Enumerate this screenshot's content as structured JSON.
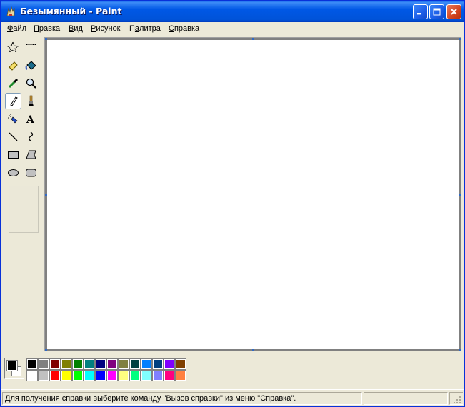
{
  "window": {
    "title": "Безымянный - Paint"
  },
  "menu": [
    {
      "label_pre": "",
      "label_ul": "Ф",
      "label_post": "айл"
    },
    {
      "label_pre": "",
      "label_ul": "П",
      "label_post": "равка"
    },
    {
      "label_pre": "",
      "label_ul": "В",
      "label_post": "ид"
    },
    {
      "label_pre": "",
      "label_ul": "Р",
      "label_post": "исунок"
    },
    {
      "label_pre": "П",
      "label_ul": "а",
      "label_post": "литра"
    },
    {
      "label_pre": "",
      "label_ul": "С",
      "label_post": "правка"
    }
  ],
  "tools": [
    "free-select-icon",
    "rect-select-icon",
    "eraser-icon",
    "fill-bucket-icon",
    "color-picker-icon",
    "magnifier-icon",
    "pencil-icon",
    "brush-icon",
    "airbrush-icon",
    "text-icon",
    "line-icon",
    "curve-icon",
    "rectangle-icon",
    "polygon-icon",
    "ellipse-icon",
    "rounded-rect-icon"
  ],
  "selected_tool": "pencil-icon",
  "colors": {
    "foreground": "#000000",
    "background": "#ffffff",
    "palette_top": [
      "#000000",
      "#808080",
      "#800000",
      "#808000",
      "#008000",
      "#008080",
      "#000080",
      "#800080",
      "#808040",
      "#004040",
      "#0080ff",
      "#004080",
      "#8000ff",
      "#804000"
    ],
    "palette_bottom": [
      "#ffffff",
      "#c0c0c0",
      "#ff0000",
      "#ffff00",
      "#00ff00",
      "#00ffff",
      "#0000ff",
      "#ff00ff",
      "#ffff80",
      "#00ff80",
      "#80ffff",
      "#8080ff",
      "#ff0080",
      "#ff8040"
    ]
  },
  "status": {
    "text": "Для получения справки выберите команду \"Вызов справки\" из меню \"Справка\"."
  }
}
